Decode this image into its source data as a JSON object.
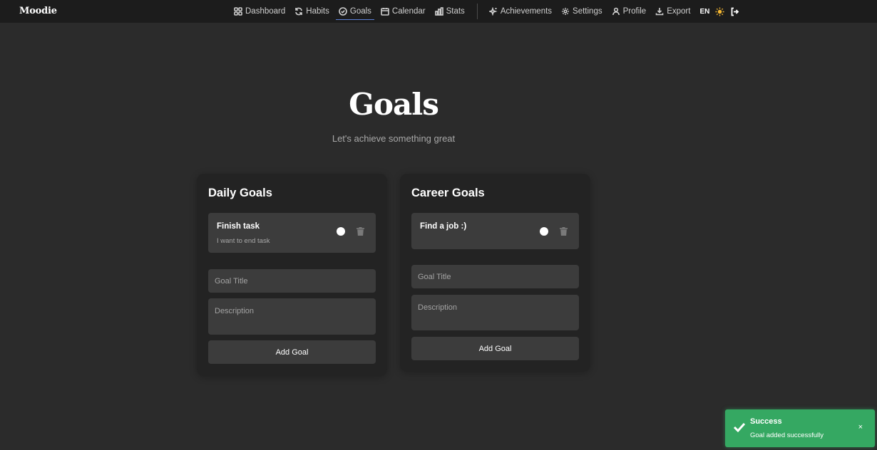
{
  "app": {
    "brand": "Moodie"
  },
  "nav": {
    "items": [
      {
        "label": "Dashboard",
        "icon": "grid-icon",
        "active": false
      },
      {
        "label": "Habits",
        "icon": "refresh-icon",
        "active": false
      },
      {
        "label": "Goals",
        "icon": "check-circle-icon",
        "active": true
      },
      {
        "label": "Calendar",
        "icon": "calendar-icon",
        "active": false
      },
      {
        "label": "Stats",
        "icon": "bar-chart-icon",
        "active": false
      },
      {
        "label": "Achievements",
        "icon": "sparkles-icon",
        "active": false
      },
      {
        "label": "Settings",
        "icon": "gear-icon",
        "active": false
      },
      {
        "label": "Profile",
        "icon": "user-icon",
        "active": false
      },
      {
        "label": "Export",
        "icon": "download-icon",
        "active": false
      }
    ],
    "language": "EN",
    "theme_icon": "sun-icon",
    "logout_icon": "logout-icon"
  },
  "page": {
    "title": "Goals",
    "subtitle": "Let's achieve something great"
  },
  "cards": {
    "daily": {
      "title": "Daily Goals",
      "goals": [
        {
          "title": "Finish task",
          "description": "I want to end task"
        }
      ],
      "title_placeholder": "Goal Title",
      "description_placeholder": "Description",
      "add_label": "Add Goal"
    },
    "career": {
      "title": "Career Goals",
      "goals": [
        {
          "title": "Find a job :)",
          "description": ""
        }
      ],
      "title_placeholder": "Goal Title",
      "description_placeholder": "Description",
      "add_label": "Add Goal"
    }
  },
  "toast": {
    "title": "Success",
    "message": "Goal added successfully",
    "close": "×",
    "color": "#35a862"
  },
  "colors": {
    "background": "#2b2b2b",
    "topbar": "#1c1c1c",
    "card": "#232323",
    "field": "#3c3c3c",
    "active_underline": "#5b7fd6",
    "sun": "#f5b731"
  }
}
